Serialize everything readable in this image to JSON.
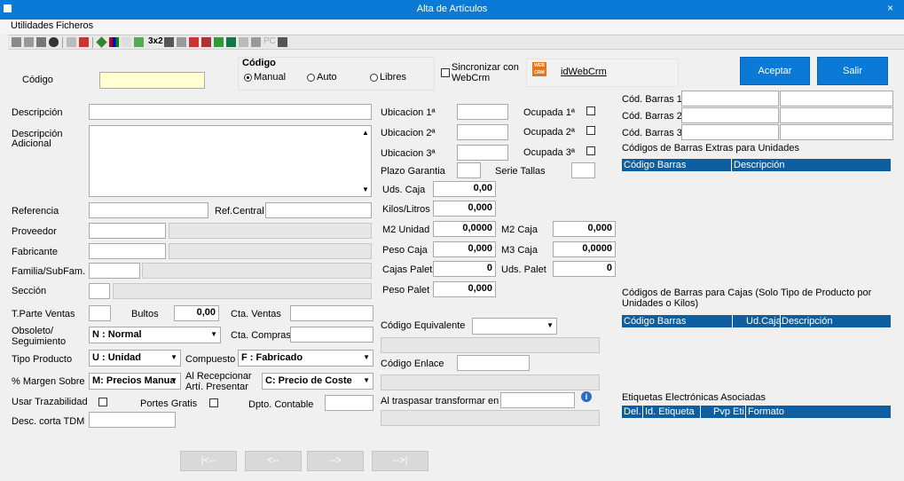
{
  "window": {
    "title": "Alta de Artículos",
    "close_label": "×"
  },
  "menu": {
    "utilidades": "Utilidades",
    "ficheros": "Ficheros"
  },
  "toolbar": {
    "label_3x2": "3x2",
    "label_pc": "PC"
  },
  "codigo": {
    "label": "Código",
    "value": "",
    "group_label": "Código",
    "radio_manual": "Manual",
    "radio_auto": "Auto",
    "radio_libres": "Libres",
    "selected": "Manual"
  },
  "sync": {
    "label_line1": "Sincronizar con",
    "label_line2": "WebCrm",
    "checked": false,
    "logo_text": "WEB CRM",
    "link": "idWebCrm"
  },
  "buttons": {
    "aceptar": "Aceptar",
    "salir": "Salir"
  },
  "form": {
    "descripcion": "Descripción",
    "descripcion_adicional_1": "Descripción",
    "descripcion_adicional_2": "Adicional",
    "referencia": "Referencia",
    "ref_central": "Ref.Central",
    "proveedor": "Proveedor",
    "fabricante": "Fabricante",
    "familia": "Familia/SubFam.",
    "seccion": "Sección",
    "t_parte_ventas": "T.Parte Ventas",
    "bultos": "Bultos",
    "bultos_value": "0,00",
    "cta_ventas": "Cta. Ventas",
    "obsoleto_1": "Obsoleto/",
    "obsoleto_2": "Seguimiento",
    "obsoleto_value": "N : Normal",
    "cta_compras": "Cta. Compras",
    "tipo_producto": "Tipo Producto",
    "tipo_producto_value": "U : Unidad",
    "compuesto": "Compuesto",
    "compuesto_value": "F : Fabricado",
    "margen": "% Margen Sobre",
    "margen_value": "M: Precios Manua",
    "al_recepcionar_1": "Al Recepcionar",
    "al_recepcionar_2": "Artí. Presentar",
    "al_recepcionar_value": "C: Precio de Coste",
    "usar_trazabilidad": "Usar Trazabilidad",
    "portes_gratis": "Portes Gratis",
    "dpto_contable": "Dpto. Contable",
    "desc_corta": "Desc. corta TDM"
  },
  "ubicaciones": {
    "ubicacion1": "Ubicacion 1ª",
    "ubicacion2": "Ubicacion 2ª",
    "ubicacion3": "Ubicacion 3ª",
    "ocupada1": "Ocupada 1ª",
    "ocupada2": "Ocupada 2ª",
    "ocupada3": "Ocupada 3ª",
    "plazo_garantia": "Plazo Garantia",
    "serie_tallas": "Serie Tallas"
  },
  "medidas": {
    "uds_caja": "Uds. Caja",
    "uds_caja_value": "0,00",
    "kilos_litros": "Kilos/Litros",
    "kilos_litros_value": "0,000",
    "m2_unidad": "M2 Unidad",
    "m2_unidad_value": "0,0000",
    "m2_caja": "M2 Caja",
    "m2_caja_value": "0,000",
    "peso_caja": "Peso Caja",
    "peso_caja_value": "0,000",
    "m3_caja": "M3 Caja",
    "m3_caja_value": "0,0000",
    "cajas_palet": "Cajas Palet",
    "cajas_palet_value": "0",
    "uds_palet": "Uds. Palet",
    "uds_palet_value": "0",
    "peso_palet": "Peso Palet",
    "peso_palet_value": "0,000"
  },
  "equivalencias": {
    "codigo_equivalente": "Código Equivalente",
    "codigo_enlace": "Código Enlace",
    "al_traspasar": "Al traspasar transformar en"
  },
  "barras": {
    "cod_barras_1": "Cód. Barras 1",
    "cod_barras_2": "Cód. Barras 2",
    "cod_barras_3": "Cód. Barras 3",
    "extras_title": "Códigos de Barras Extras para Unidades",
    "extras_cols": [
      "Código Barras",
      "Descripción"
    ],
    "cajas_title_1": "Códigos de Barras para Cajas  (Solo Tipo de Producto por",
    "cajas_title_2": "Unidades o Kilos)",
    "cajas_cols": [
      "Código Barras",
      "Ud.Caja",
      "Descripción"
    ],
    "etiquetas_title": "Etiquetas Electrónicas Asociadas",
    "etiquetas_cols": [
      "Del.",
      "Id. Etiqueta",
      "Pvp Eti.",
      "Formato"
    ]
  },
  "nav": {
    "first": "|<--",
    "prev": "<--",
    "next": "-->",
    "last": "-->|"
  }
}
